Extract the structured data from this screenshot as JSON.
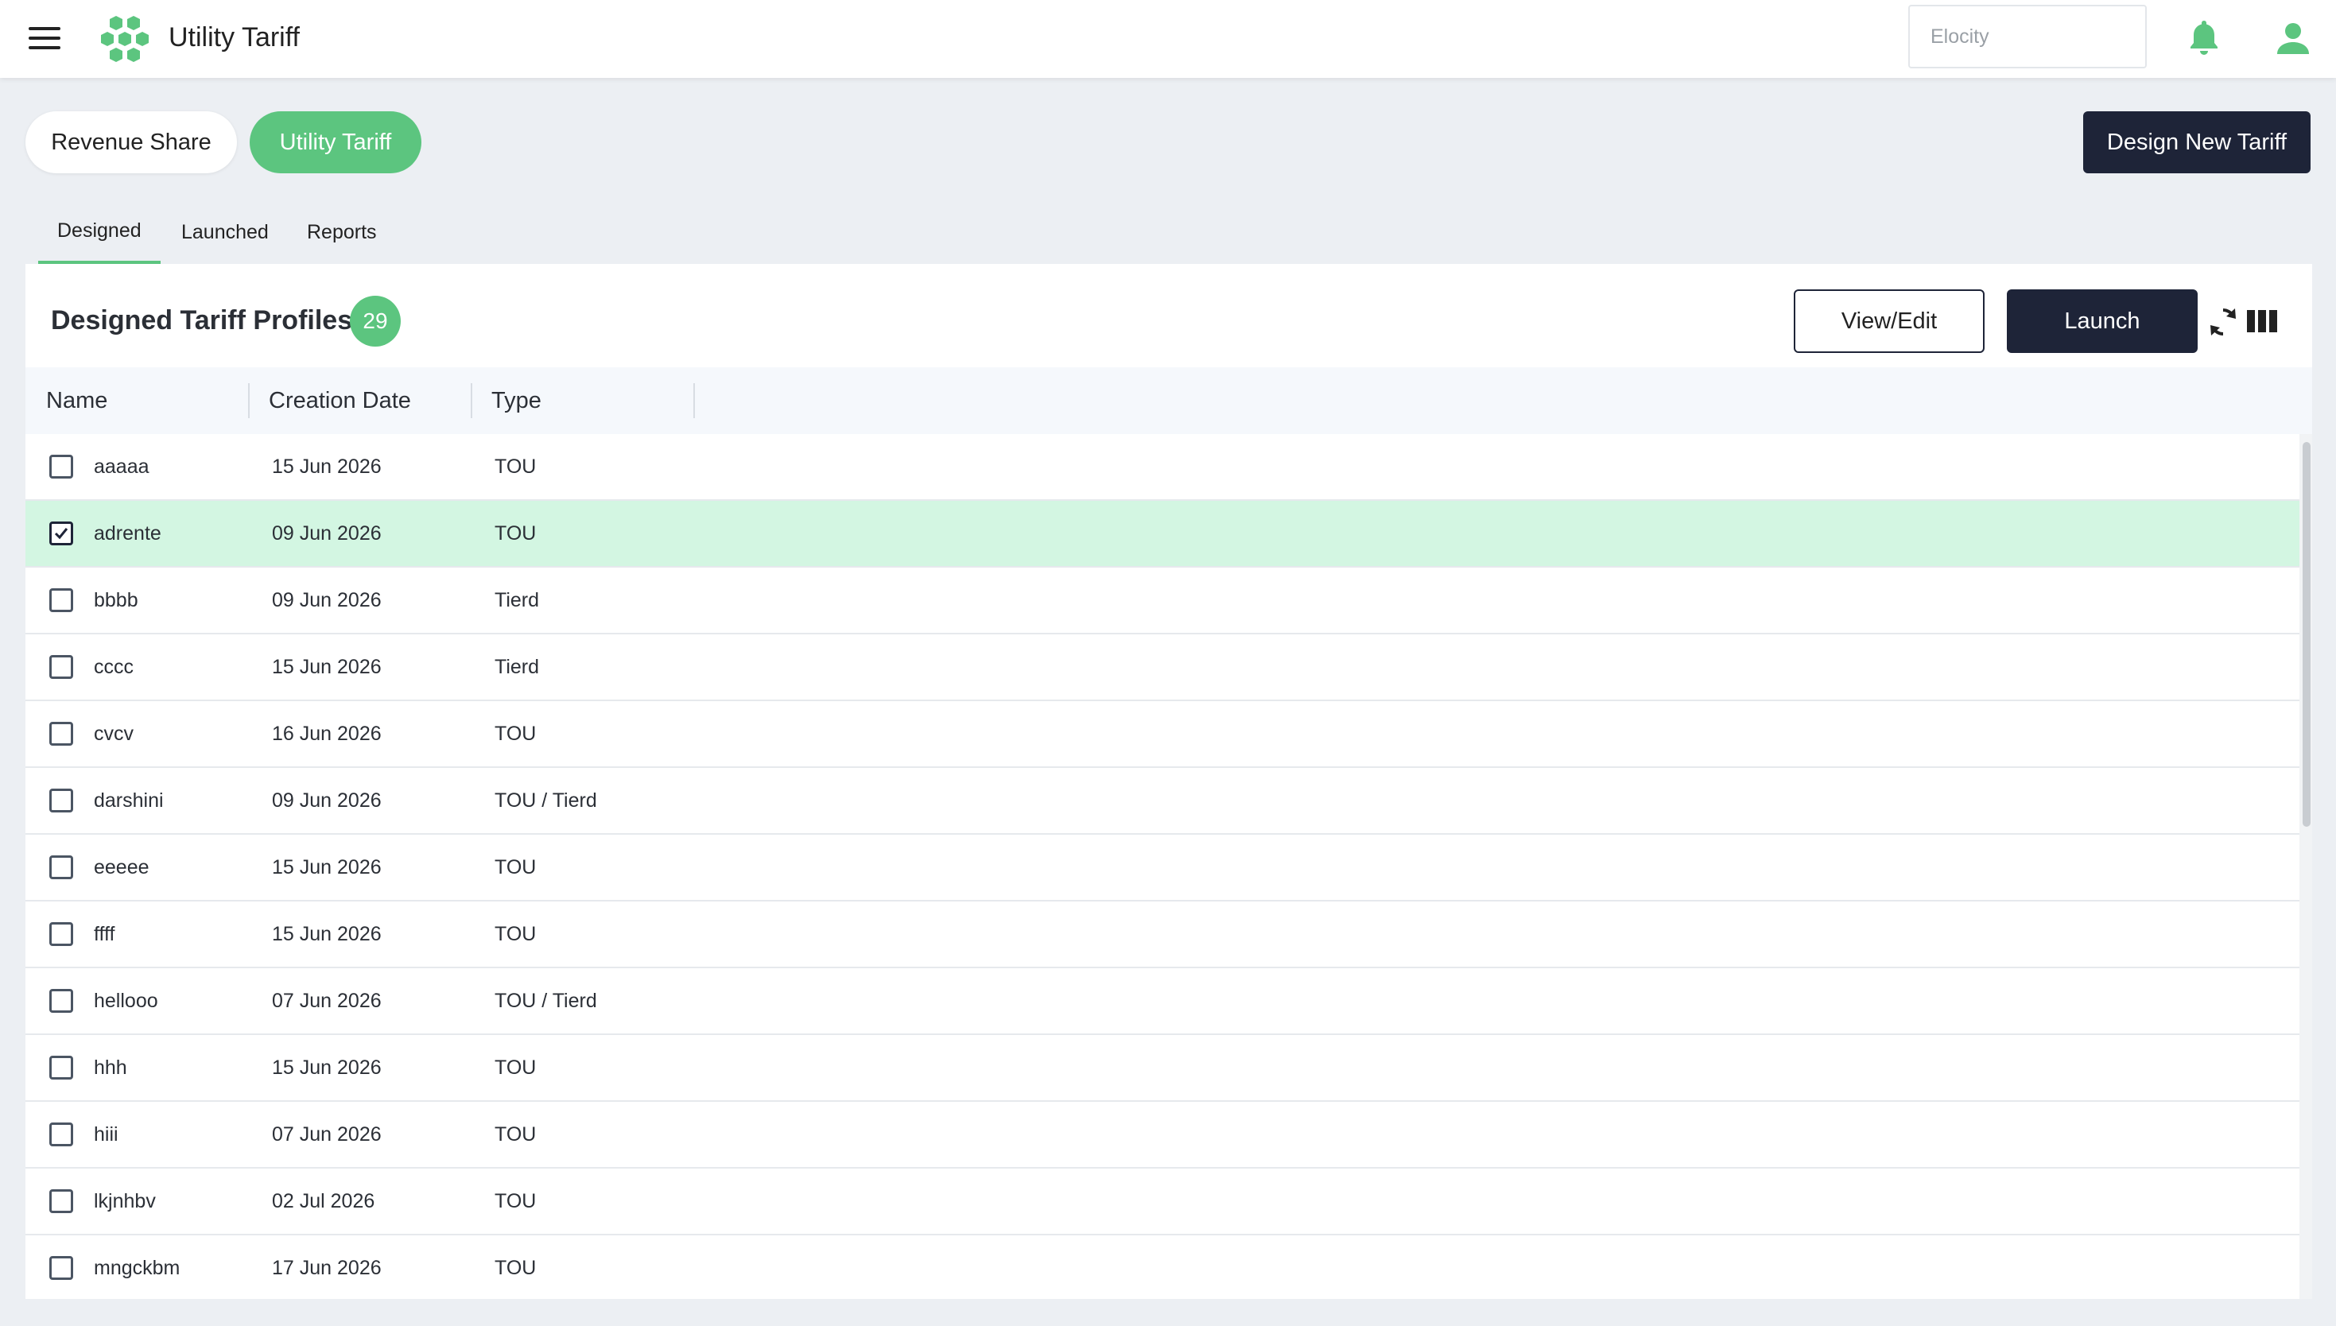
{
  "header": {
    "app_title": "Utility Tariff",
    "search_placeholder": "Elocity",
    "accent_color": "#5cc57f"
  },
  "toggle": {
    "revenue_share": "Revenue Share",
    "utility_tariff": "Utility Tariff"
  },
  "actions": {
    "design_new": "Design New Tariff",
    "view_edit": "View/Edit",
    "launch": "Launch"
  },
  "tabs": [
    {
      "label": "Designed",
      "active": true
    },
    {
      "label": "Launched",
      "active": false
    },
    {
      "label": "Reports",
      "active": false
    }
  ],
  "panel": {
    "title": "Designed Tariff Profiles",
    "count": "29"
  },
  "table": {
    "columns": [
      "Name",
      "Creation Date",
      "Type"
    ],
    "rows": [
      {
        "name": "aaaaa",
        "date": "15 Jun 2026",
        "type": "TOU",
        "checked": false
      },
      {
        "name": "adrente",
        "date": "09 Jun 2026",
        "type": "TOU",
        "checked": true
      },
      {
        "name": "bbbb",
        "date": "09 Jun 2026",
        "type": "Tierd",
        "checked": false
      },
      {
        "name": "cccc",
        "date": "15 Jun 2026",
        "type": "Tierd",
        "checked": false
      },
      {
        "name": "cvcv",
        "date": "16 Jun 2026",
        "type": "TOU",
        "checked": false
      },
      {
        "name": "darshini",
        "date": "09 Jun 2026",
        "type": "TOU / Tierd",
        "checked": false
      },
      {
        "name": "eeeee",
        "date": "15 Jun 2026",
        "type": "TOU",
        "checked": false
      },
      {
        "name": "ffff",
        "date": "15 Jun 2026",
        "type": "TOU",
        "checked": false
      },
      {
        "name": "hellooo",
        "date": "07 Jun 2026",
        "type": "TOU / Tierd",
        "checked": false
      },
      {
        "name": "hhh",
        "date": "15 Jun 2026",
        "type": "TOU",
        "checked": false
      },
      {
        "name": "hiii",
        "date": "07 Jun 2026",
        "type": "TOU",
        "checked": false
      },
      {
        "name": "lkjnhbv",
        "date": "02 Jul 2026",
        "type": "TOU",
        "checked": false
      },
      {
        "name": "mngckbm",
        "date": "17 Jun 2026",
        "type": "TOU",
        "checked": false
      }
    ]
  }
}
